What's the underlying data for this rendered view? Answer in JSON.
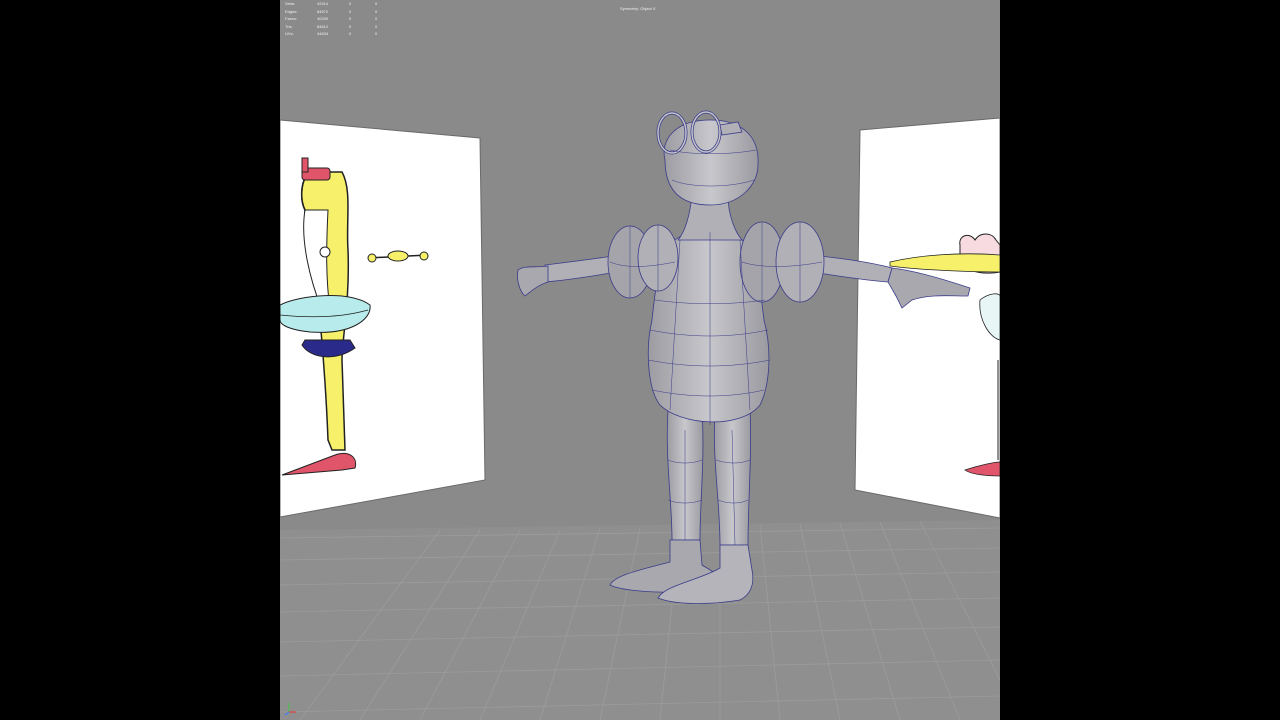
{
  "hud": {
    "rows": [
      {
        "label": "Verts:",
        "value": "42414",
        "sel": "0",
        "sel2": "0"
      },
      {
        "label": "Edges:",
        "value": "84672",
        "sel": "0",
        "sel2": "0"
      },
      {
        "label": "Faces:",
        "value": "40290",
        "sel": "0",
        "sel2": "0"
      },
      {
        "label": "Tris:",
        "value": "84612",
        "sel": "0",
        "sel2": "0"
      },
      {
        "label": "UVs:",
        "value": "44634",
        "sel": "0",
        "sel2": "0"
      }
    ]
  },
  "symmetry_label": "Symmetry: Object X",
  "colors": {
    "viewport_bg": "#8a8a8a",
    "grid_line": "#9a9a9a",
    "mesh_fill": "#b4b4b8",
    "wire": "#3b3b8a",
    "image_plane": "#ffffff",
    "accent_yellow": "#f6f06a",
    "accent_red": "#e0556a",
    "accent_cyan": "#b8ecec",
    "accent_navy": "#2a2a8a"
  },
  "icons": {
    "axis_gizmo": "axis-gizmo-icon"
  }
}
